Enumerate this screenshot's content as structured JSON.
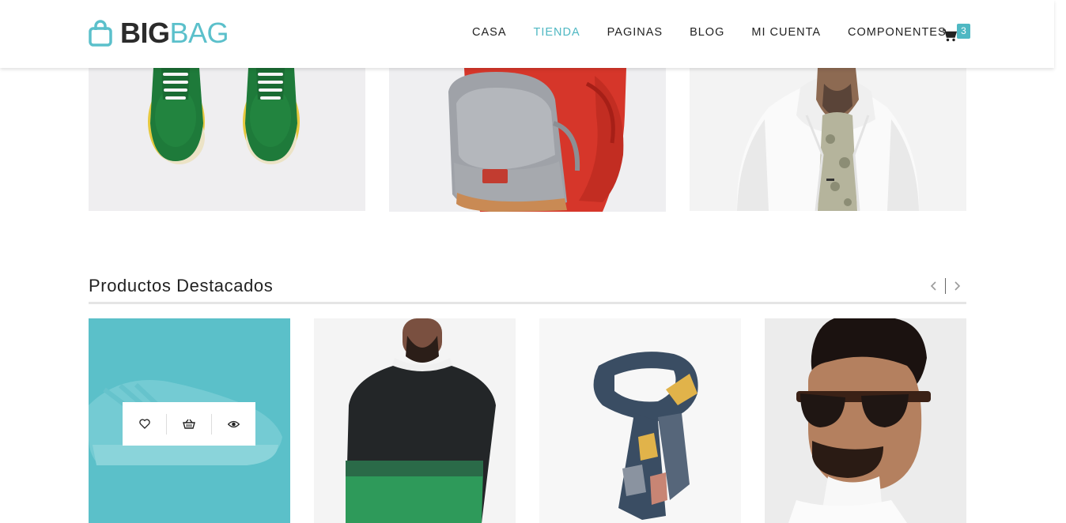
{
  "brand": {
    "part1": "BIG",
    "part2": "BAG",
    "accent": "#5bc0cb"
  },
  "nav": {
    "items": [
      {
        "label": "CASA",
        "active": false
      },
      {
        "label": "TIENDA",
        "active": true
      },
      {
        "label": "PAGINAS",
        "active": false
      },
      {
        "label": "BLOG",
        "active": false
      },
      {
        "label": "MI CUENTA",
        "active": false
      },
      {
        "label": "COMPONENTES",
        "active": false
      }
    ],
    "cart_count": "3",
    "cart_icon": "cart-icon"
  },
  "banners": [
    {
      "subject": "green-sneakers"
    },
    {
      "subject": "grey-backpack"
    },
    {
      "subject": "white-jacket"
    }
  ],
  "featured": {
    "title": "Productos Destacados",
    "prev_icon": "chevron-left-icon",
    "next_icon": "chevron-right-icon",
    "products": [
      {
        "subject": "sneaker",
        "hover": true
      },
      {
        "subject": "black-green-sweater"
      },
      {
        "subject": "scarf"
      },
      {
        "subject": "sunglasses"
      }
    ],
    "actions": [
      "heart-icon",
      "basket-icon",
      "eye-icon"
    ]
  }
}
